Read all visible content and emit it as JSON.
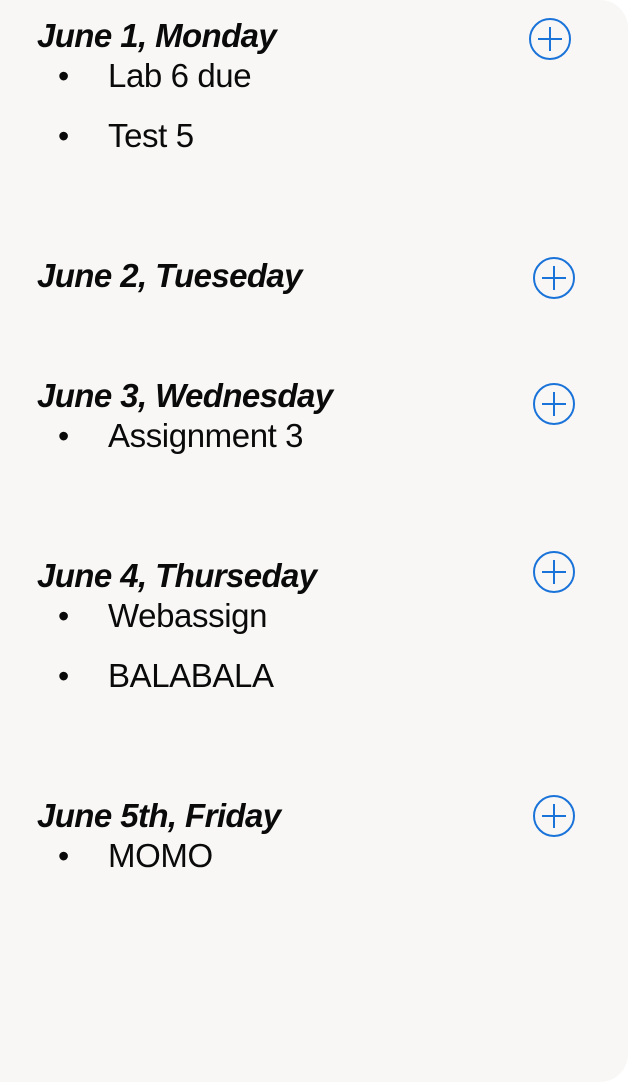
{
  "days": [
    {
      "title": "June 1, Monday",
      "tasks": [
        "Lab 6 due",
        "Test 5"
      ]
    },
    {
      "title": "June 2, Tueseday",
      "tasks": []
    },
    {
      "title": "June 3, Wednesday",
      "tasks": [
        "Assignment 3"
      ]
    },
    {
      "title": "June 4, Thurseday",
      "tasks": [
        "Webassign",
        "BALABALA"
      ]
    },
    {
      "title": "June 5th, Friday",
      "tasks": [
        "MOMO"
      ]
    }
  ],
  "colors": {
    "accent": "#1a73d9",
    "panel_background": "#f8f7f6",
    "text": "#0a0a0a"
  },
  "icons": {
    "add": "plus-circle-icon",
    "bullet": "•"
  }
}
